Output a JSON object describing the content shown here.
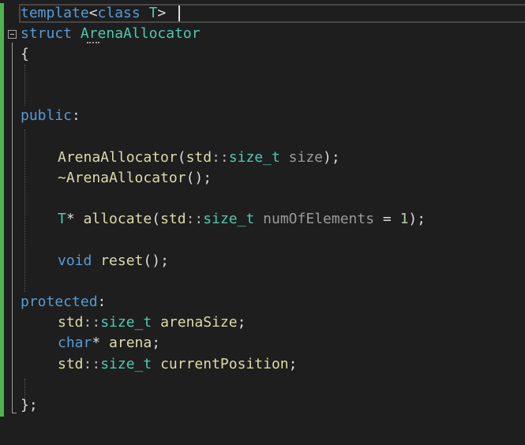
{
  "editor": {
    "lines": {
      "l1": {
        "kw1": "template",
        "p1": "<",
        "kw2": "class",
        "p2": " ",
        "type1": "T",
        "p3": ">"
      },
      "l2": {
        "kw1": "struct",
        "p1": " ",
        "type1": "ArenaAllocator"
      },
      "l3": {
        "p1": "{"
      },
      "l6": {
        "kw1": "public",
        "p1": ":"
      },
      "l8": {
        "fn1": "ArenaAllocator",
        "p1": "(",
        "t1": "std",
        "s1": "::",
        "type1": "size_t",
        "p2": " ",
        "param1": "size",
        "p3": ");"
      },
      "l9": {
        "fn1": "~ArenaAllocator",
        "p1": "();"
      },
      "l11": {
        "type1": "T",
        "p1": "* ",
        "fn1": "allocate",
        "p2": "(",
        "t1": "std",
        "s1": "::",
        "type2": "size_t",
        "p3": " ",
        "param1": "numOfElements",
        "p4": " = ",
        "num1": "1",
        "p5": ");"
      },
      "l13": {
        "kw1": "void",
        "p1": " ",
        "fn1": "reset",
        "p2": "();"
      },
      "l15": {
        "kw1": "protected",
        "p1": ":"
      },
      "l16": {
        "t1": "std",
        "s1": "::",
        "type1": "size_t",
        "p1": " ",
        "fn1": "arenaSize",
        "p2": ";"
      },
      "l17": {
        "kw1": "char",
        "p1": "* ",
        "fn1": "arena",
        "p2": ";"
      },
      "l18": {
        "t1": "std",
        "s1": "::",
        "type1": "size_t",
        "p1": " ",
        "fn1": "currentPosition",
        "p2": ";"
      },
      "l20": {
        "p1": "};"
      }
    }
  }
}
